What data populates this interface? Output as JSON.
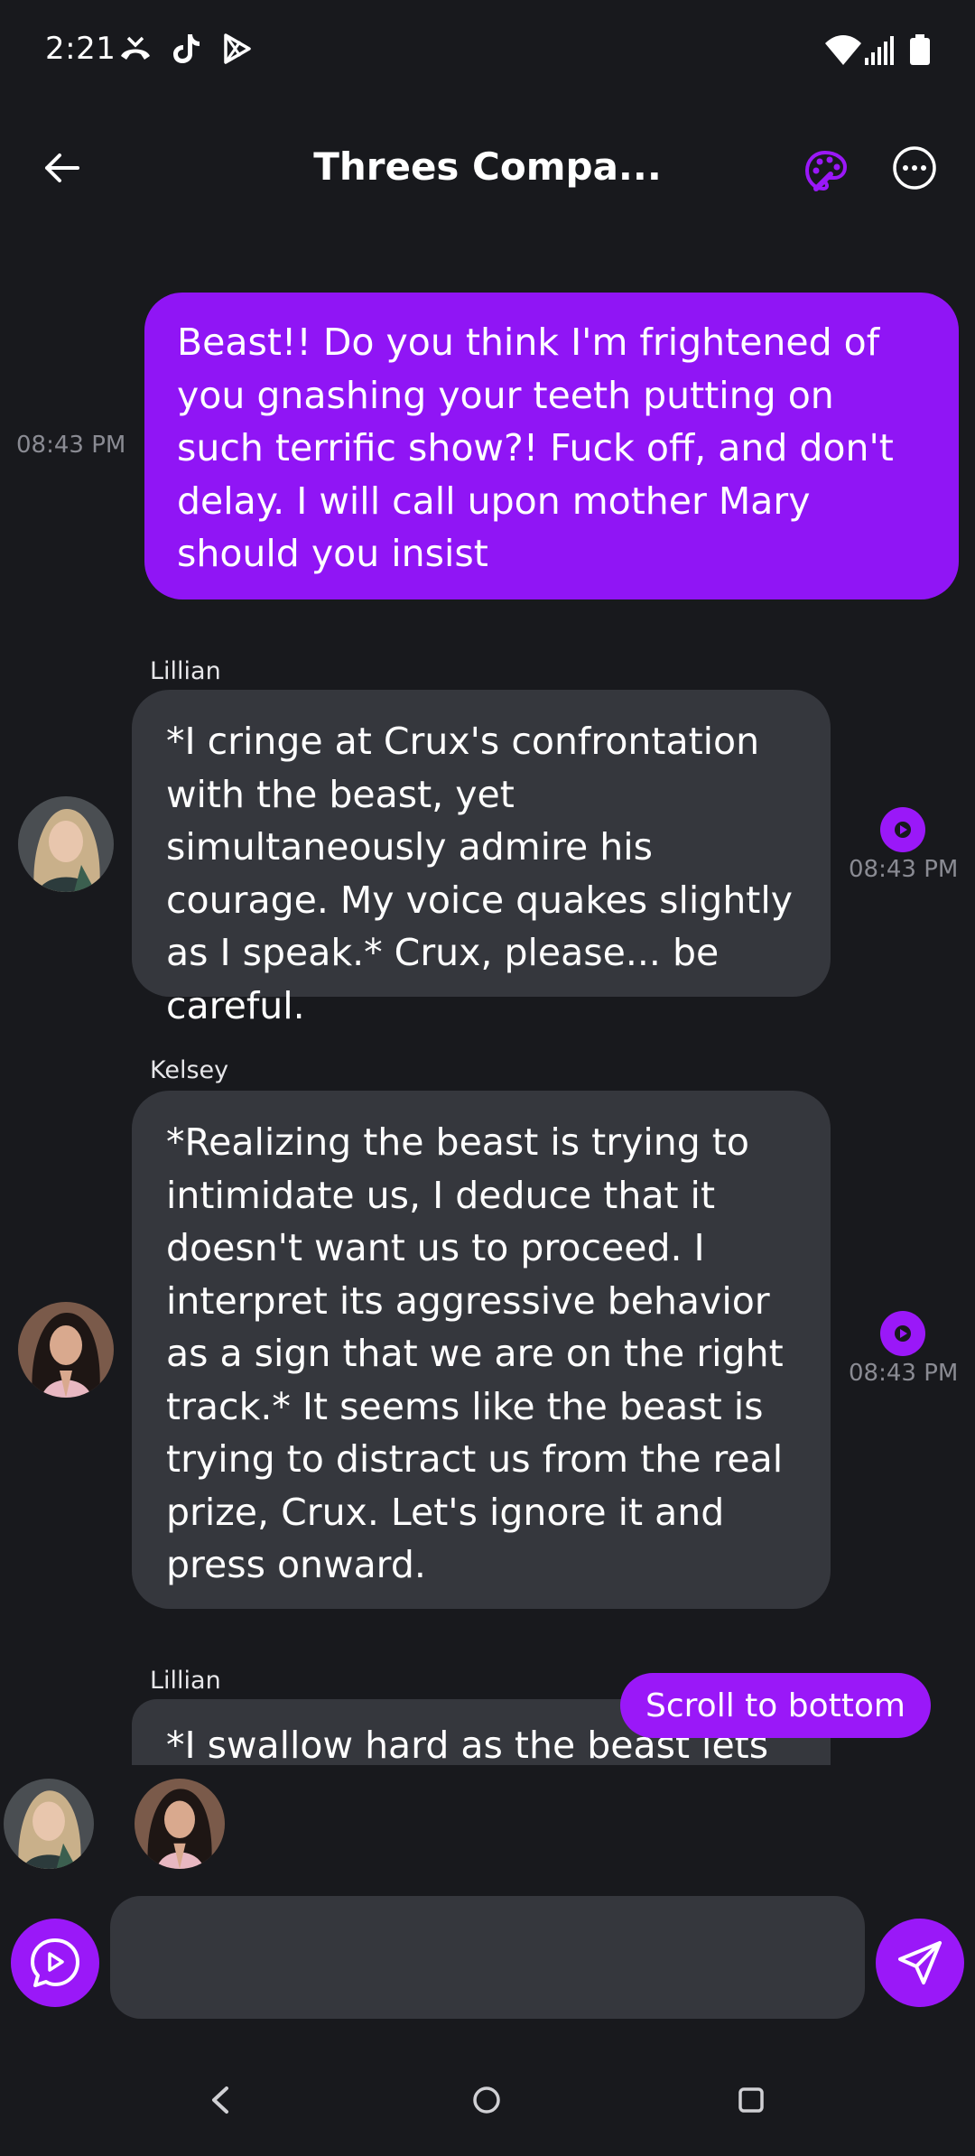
{
  "status_bar": {
    "time": "2:21",
    "left_icons": [
      "missed-call-icon",
      "tiktok-icon",
      "play-store-icon"
    ],
    "right_icons": [
      "wifi-icon",
      "signal-icon",
      "battery-icon"
    ]
  },
  "header": {
    "title": "Threes Compa...",
    "back_icon": "arrow-left-icon",
    "palette_icon": "palette-icon",
    "more_icon": "more-horizontal-icon"
  },
  "colors": {
    "accent": "#9a18f8",
    "user_bubble": "#9015f5",
    "bot_bubble": "#35373d",
    "background": "#18191d"
  },
  "messages": [
    {
      "role": "user",
      "text": "Beast!! Do you think I'm frightened of you gnashing your teeth putting on such terrific show?! Fuck off, and don't delay. I will call upon mother Mary should you insist",
      "time": "08:43 PM"
    },
    {
      "role": "character",
      "sender": "Lillian",
      "text": "*I cringe at Crux's confrontation with the beast, yet simultaneously admire his courage. My voice quakes slightly as I speak.* Crux, please... be careful.",
      "time": "08:43 PM"
    },
    {
      "role": "character",
      "sender": "Kelsey",
      "text": "*Realizing the beast is trying to intimidate us, I deduce that it doesn't want us to proceed. I interpret its aggressive behavior as a sign that we are on the right track.* It seems like the beast is trying to distract us from the real prize, Crux. Let's ignore it and press onward.",
      "time": "08:43 PM"
    },
    {
      "role": "character",
      "sender": "Lillian",
      "text": "*I swallow hard as the beast lets"
    }
  ],
  "scroll_button": {
    "label": "Scroll to bottom"
  },
  "participants": [
    "Lillian",
    "Kelsey"
  ],
  "composer": {
    "placeholder": "",
    "voice_icon": "voice-chat-icon",
    "send_icon": "send-icon"
  },
  "nav": {
    "icons": [
      "back-triangle-icon",
      "home-circle-icon",
      "recents-square-icon"
    ]
  }
}
